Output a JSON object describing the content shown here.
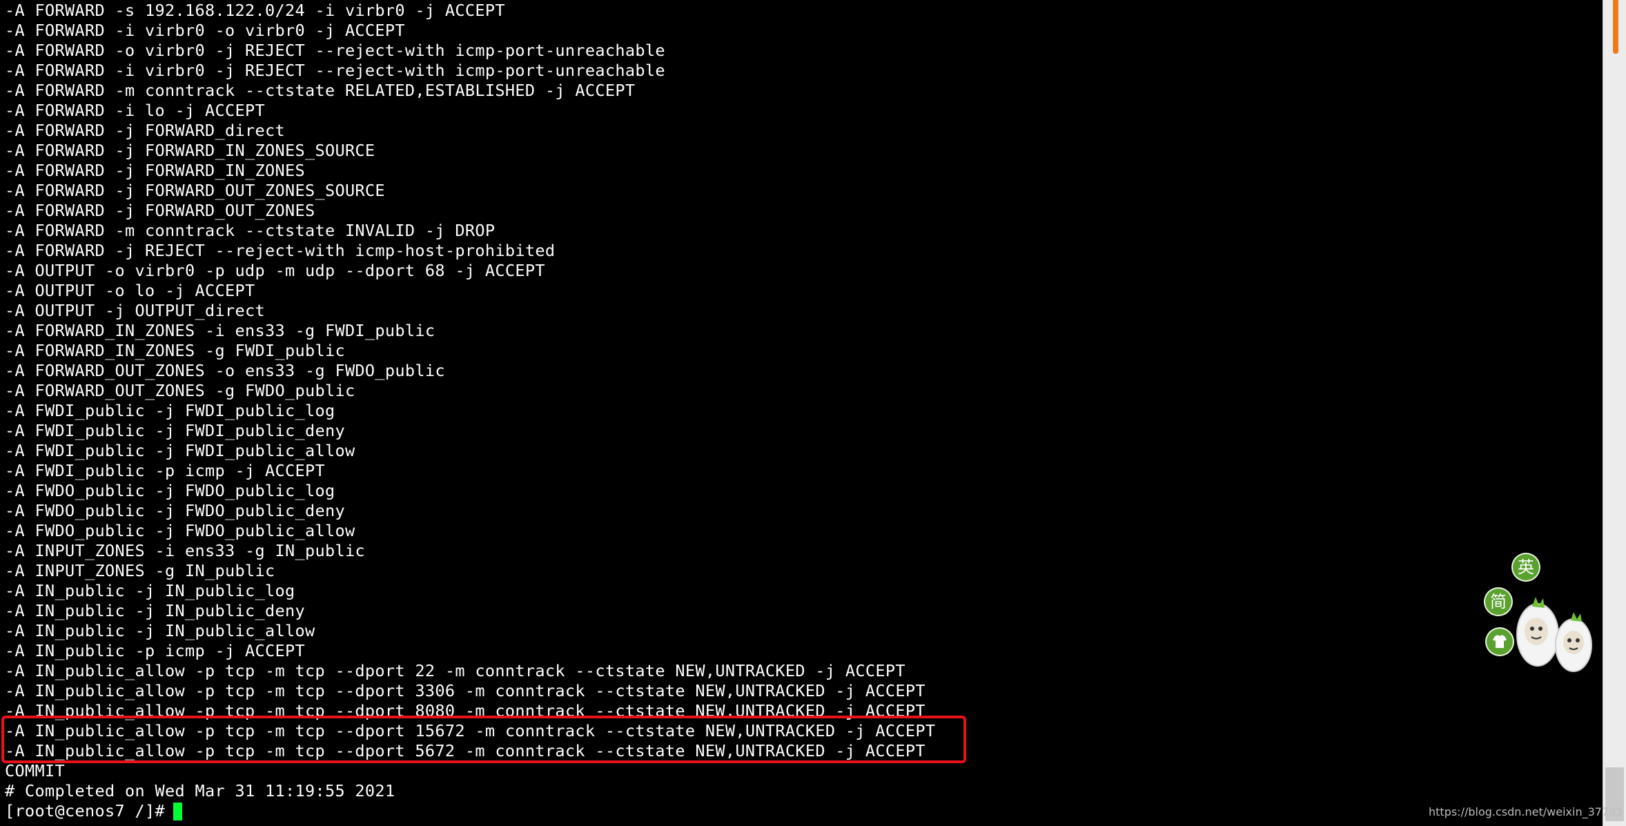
{
  "terminal": {
    "lines": [
      "-A FORWARD -s 192.168.122.0/24 -i virbr0 -j ACCEPT",
      "-A FORWARD -i virbr0 -o virbr0 -j ACCEPT",
      "-A FORWARD -o virbr0 -j REJECT --reject-with icmp-port-unreachable",
      "-A FORWARD -i virbr0 -j REJECT --reject-with icmp-port-unreachable",
      "-A FORWARD -m conntrack --ctstate RELATED,ESTABLISHED -j ACCEPT",
      "-A FORWARD -i lo -j ACCEPT",
      "-A FORWARD -j FORWARD_direct",
      "-A FORWARD -j FORWARD_IN_ZONES_SOURCE",
      "-A FORWARD -j FORWARD_IN_ZONES",
      "-A FORWARD -j FORWARD_OUT_ZONES_SOURCE",
      "-A FORWARD -j FORWARD_OUT_ZONES",
      "-A FORWARD -m conntrack --ctstate INVALID -j DROP",
      "-A FORWARD -j REJECT --reject-with icmp-host-prohibited",
      "-A OUTPUT -o virbr0 -p udp -m udp --dport 68 -j ACCEPT",
      "-A OUTPUT -o lo -j ACCEPT",
      "-A OUTPUT -j OUTPUT_direct",
      "-A FORWARD_IN_ZONES -i ens33 -g FWDI_public",
      "-A FORWARD_IN_ZONES -g FWDI_public",
      "-A FORWARD_OUT_ZONES -o ens33 -g FWDO_public",
      "-A FORWARD_OUT_ZONES -g FWDO_public",
      "-A FWDI_public -j FWDI_public_log",
      "-A FWDI_public -j FWDI_public_deny",
      "-A FWDI_public -j FWDI_public_allow",
      "-A FWDI_public -p icmp -j ACCEPT",
      "-A FWDO_public -j FWDO_public_log",
      "-A FWDO_public -j FWDO_public_deny",
      "-A FWDO_public -j FWDO_public_allow",
      "-A INPUT_ZONES -i ens33 -g IN_public",
      "-A INPUT_ZONES -g IN_public",
      "-A IN_public -j IN_public_log",
      "-A IN_public -j IN_public_deny",
      "-A IN_public -j IN_public_allow",
      "-A IN_public -p icmp -j ACCEPT",
      "-A IN_public_allow -p tcp -m tcp --dport 22 -m conntrack --ctstate NEW,UNTRACKED -j ACCEPT",
      "-A IN_public_allow -p tcp -m tcp --dport 3306 -m conntrack --ctstate NEW,UNTRACKED -j ACCEPT",
      "-A IN_public_allow -p tcp -m tcp --dport 8080 -m conntrack --ctstate NEW,UNTRACKED -j ACCEPT",
      "-A IN_public_allow -p tcp -m tcp --dport 15672 -m conntrack --ctstate NEW,UNTRACKED -j ACCEPT",
      "-A IN_public_allow -p tcp -m tcp --dport 5672 -m conntrack --ctstate NEW,UNTRACKED -j ACCEPT",
      "COMMIT",
      "# Completed on Wed Mar 31 11:19:55 2021"
    ],
    "prompt": "[root@cenos7 /]#"
  },
  "ime": {
    "lang_label": "英",
    "mode_label": "简",
    "skin_icon": "shirt-icon",
    "mascot_icon": "mascot-icon",
    "accent_color": "#5aa130"
  },
  "watermark": "https://blog.csdn.net/weixin_37783",
  "colors": {
    "background": "#000000",
    "text": "#ffffff",
    "cursor": "#00ff33",
    "highlight": "#e8121c"
  }
}
